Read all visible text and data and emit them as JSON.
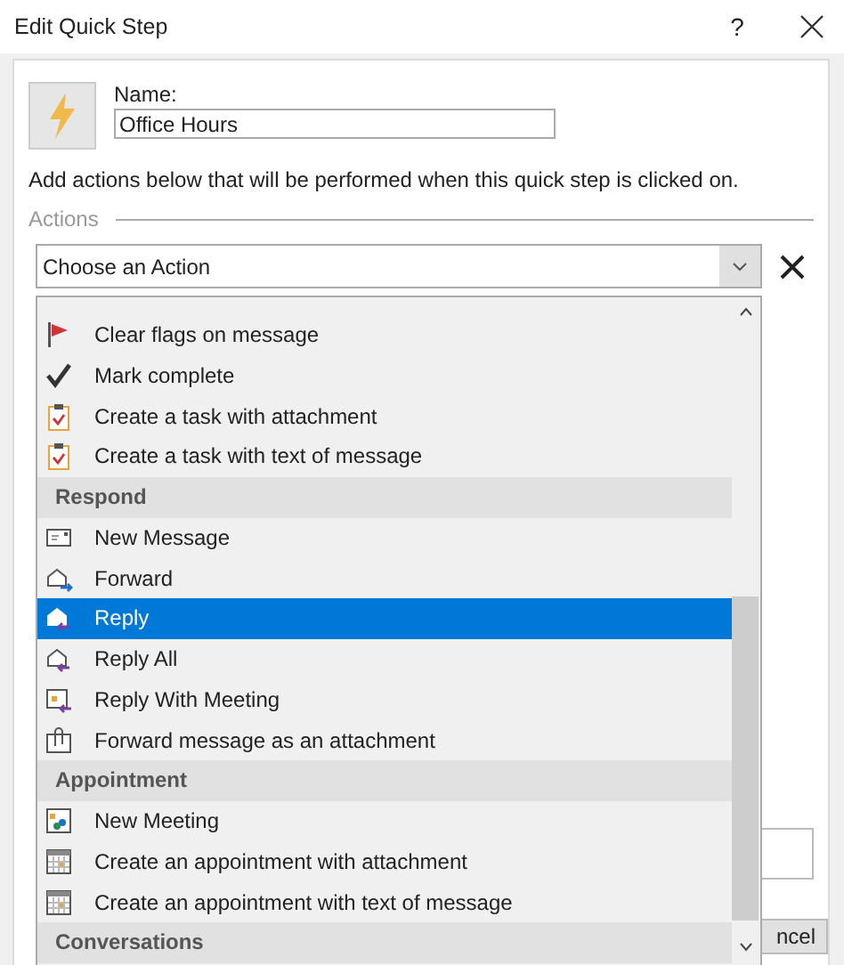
{
  "window": {
    "title": "Edit Quick Step",
    "help": "?"
  },
  "name_label": "Name:",
  "name_value": "Office Hours",
  "description": "Add actions below that will be performed when this quick step is clicked on.",
  "actions_label": "Actions",
  "action_select": {
    "value": "Choose an Action"
  },
  "dropdown_items": [
    {
      "kind": "item",
      "label": "Clear flags on message",
      "selected": false
    },
    {
      "kind": "item",
      "label": "Mark complete",
      "selected": false
    },
    {
      "kind": "item",
      "label": "Create a task with attachment",
      "selected": false
    },
    {
      "kind": "item",
      "label": "Create a task with text of message",
      "selected": false
    },
    {
      "kind": "header",
      "label": "Respond"
    },
    {
      "kind": "item",
      "label": "New Message",
      "selected": false
    },
    {
      "kind": "item",
      "label": "Forward",
      "selected": false
    },
    {
      "kind": "item",
      "label": "Reply",
      "selected": true
    },
    {
      "kind": "item",
      "label": "Reply All",
      "selected": false
    },
    {
      "kind": "item",
      "label": "Reply With Meeting",
      "selected": false
    },
    {
      "kind": "item",
      "label": "Forward message as an attachment",
      "selected": false
    },
    {
      "kind": "header",
      "label": "Appointment"
    },
    {
      "kind": "item",
      "label": "New Meeting",
      "selected": false
    },
    {
      "kind": "item",
      "label": "Create an appointment with attachment",
      "selected": false
    },
    {
      "kind": "item",
      "label": "Create an appointment with text of message",
      "selected": false
    },
    {
      "kind": "header",
      "label": "Conversations"
    }
  ],
  "cancel_button": "ncel"
}
